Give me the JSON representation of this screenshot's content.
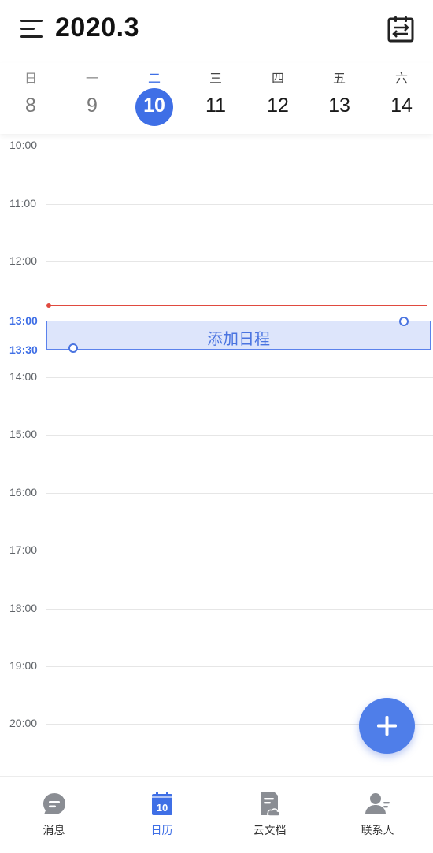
{
  "header": {
    "title": "2020.3"
  },
  "week": [
    {
      "dow": "日",
      "day": "8"
    },
    {
      "dow": "一",
      "day": "9"
    },
    {
      "dow": "二",
      "day": "10"
    },
    {
      "dow": "三",
      "day": "11"
    },
    {
      "dow": "四",
      "day": "12"
    },
    {
      "dow": "五",
      "day": "13"
    },
    {
      "dow": "六",
      "day": "14"
    }
  ],
  "timeline": {
    "hours": [
      "10:00",
      "11:00",
      "12:00",
      "13:00",
      "14:00",
      "15:00",
      "16:00",
      "17:00",
      "18:00",
      "19:00",
      "20:00"
    ],
    "selection_start": "13:00",
    "selection_end": "13:30",
    "new_event_label": "添加日程"
  },
  "colors": {
    "accent": "#3f6fe6",
    "now_line": "#e04a3f",
    "selection_fill": "#dde5fb"
  },
  "nav": [
    {
      "label": "消息",
      "icon": "message-icon"
    },
    {
      "label": "日历",
      "icon": "calendar-icon",
      "icon_text": "10"
    },
    {
      "label": "云文档",
      "icon": "cloud-doc-icon"
    },
    {
      "label": "联系人",
      "icon": "contacts-icon"
    }
  ]
}
